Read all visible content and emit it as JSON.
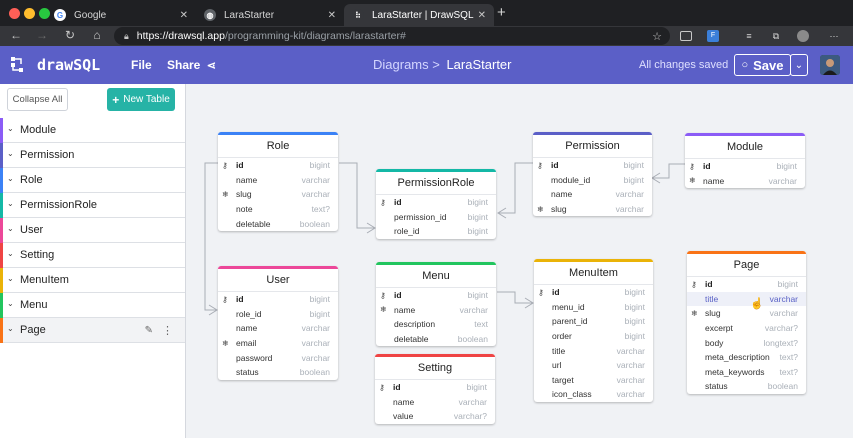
{
  "browser": {
    "tabs": [
      {
        "title": "Google",
        "active": false
      },
      {
        "title": "LaraStarter",
        "active": false
      },
      {
        "title": "LaraStarter | DrawSQL",
        "active": true
      }
    ],
    "url_host": "https://drawsql.app",
    "url_path": "/programming-kit/diagrams/larastarter#"
  },
  "app": {
    "logo_text": "drawSQL",
    "nav": {
      "file": "File",
      "share": "Share"
    },
    "breadcrumb": {
      "parent": "Diagrams >",
      "current": "LaraStarter"
    },
    "status": "All changes saved",
    "save_label": "Save"
  },
  "sidebar": {
    "collapse_all": "Collapse All",
    "new_table": "New Table",
    "items": [
      {
        "label": "Module",
        "color": "#8b5cf6"
      },
      {
        "label": "Permission",
        "color": "#5b5fc7"
      },
      {
        "label": "Role",
        "color": "#3b82f6"
      },
      {
        "label": "PermissionRole",
        "color": "#14b8a6"
      },
      {
        "label": "User",
        "color": "#ec4899"
      },
      {
        "label": "Setting",
        "color": "#ef4444"
      },
      {
        "label": "MenuItem",
        "color": "#eab308"
      },
      {
        "label": "Menu",
        "color": "#22c55e"
      },
      {
        "label": "Page",
        "color": "#f97316"
      }
    ]
  },
  "tables": [
    {
      "name": "Role",
      "color": "#3b82f6",
      "fields": [
        {
          "name": "id",
          "type": "bigint",
          "icon": "key"
        },
        {
          "name": "name",
          "type": "varchar",
          "icon": ""
        },
        {
          "name": "slug",
          "type": "varchar",
          "icon": "unique"
        },
        {
          "name": "note",
          "type": "text?",
          "icon": ""
        },
        {
          "name": "deletable",
          "type": "boolean",
          "icon": ""
        }
      ]
    },
    {
      "name": "PermissionRole",
      "color": "#14b8a6",
      "fields": [
        {
          "name": "id",
          "type": "bigint",
          "icon": "key"
        },
        {
          "name": "permission_id",
          "type": "bigint",
          "icon": ""
        },
        {
          "name": "role_id",
          "type": "bigint",
          "icon": ""
        }
      ]
    },
    {
      "name": "Permission",
      "color": "#5b5fc7",
      "fields": [
        {
          "name": "id",
          "type": "bigint",
          "icon": "key"
        },
        {
          "name": "module_id",
          "type": "bigint",
          "icon": ""
        },
        {
          "name": "name",
          "type": "varchar",
          "icon": ""
        },
        {
          "name": "slug",
          "type": "varchar",
          "icon": "unique"
        }
      ]
    },
    {
      "name": "Module",
      "color": "#8b5cf6",
      "fields": [
        {
          "name": "id",
          "type": "bigint",
          "icon": "key"
        },
        {
          "name": "name",
          "type": "varchar",
          "icon": "unique"
        }
      ]
    },
    {
      "name": "User",
      "color": "#ec4899",
      "fields": [
        {
          "name": "id",
          "type": "bigint",
          "icon": "key"
        },
        {
          "name": "role_id",
          "type": "bigint",
          "icon": ""
        },
        {
          "name": "name",
          "type": "varchar",
          "icon": ""
        },
        {
          "name": "email",
          "type": "varchar",
          "icon": "unique"
        },
        {
          "name": "password",
          "type": "varchar",
          "icon": ""
        },
        {
          "name": "status",
          "type": "boolean",
          "icon": ""
        }
      ]
    },
    {
      "name": "Menu",
      "color": "#22c55e",
      "fields": [
        {
          "name": "id",
          "type": "bigint",
          "icon": "key"
        },
        {
          "name": "name",
          "type": "varchar",
          "icon": "unique"
        },
        {
          "name": "description",
          "type": "text",
          "icon": ""
        },
        {
          "name": "deletable",
          "type": "boolean",
          "icon": ""
        }
      ]
    },
    {
      "name": "Setting",
      "color": "#ef4444",
      "fields": [
        {
          "name": "id",
          "type": "bigint",
          "icon": "key"
        },
        {
          "name": "name",
          "type": "varchar",
          "icon": ""
        },
        {
          "name": "value",
          "type": "varchar?",
          "icon": ""
        }
      ]
    },
    {
      "name": "MenuItem",
      "color": "#eab308",
      "fields": [
        {
          "name": "id",
          "type": "bigint",
          "icon": "key"
        },
        {
          "name": "menu_id",
          "type": "bigint",
          "icon": ""
        },
        {
          "name": "parent_id",
          "type": "bigint",
          "icon": ""
        },
        {
          "name": "order",
          "type": "bigint",
          "icon": ""
        },
        {
          "name": "title",
          "type": "varchar",
          "icon": ""
        },
        {
          "name": "url",
          "type": "varchar",
          "icon": ""
        },
        {
          "name": "target",
          "type": "varchar",
          "icon": ""
        },
        {
          "name": "icon_class",
          "type": "varchar",
          "icon": ""
        }
      ]
    },
    {
      "name": "Page",
      "color": "#f97316",
      "fields": [
        {
          "name": "id",
          "type": "bigint",
          "icon": "key"
        },
        {
          "name": "title",
          "type": "varchar",
          "icon": "",
          "highlight": true
        },
        {
          "name": "slug",
          "type": "varchar",
          "icon": "unique"
        },
        {
          "name": "excerpt",
          "type": "varchar?",
          "icon": ""
        },
        {
          "name": "body",
          "type": "longtext?",
          "icon": ""
        },
        {
          "name": "meta_description",
          "type": "text?",
          "icon": ""
        },
        {
          "name": "meta_keywords",
          "type": "text?",
          "icon": ""
        },
        {
          "name": "status",
          "type": "boolean",
          "icon": ""
        }
      ]
    }
  ]
}
